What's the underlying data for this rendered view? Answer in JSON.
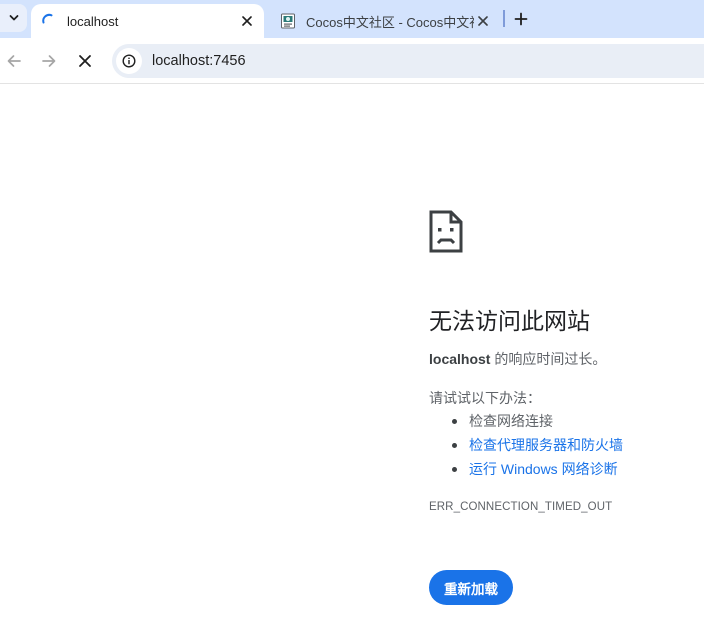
{
  "tabs": [
    {
      "title": "localhost",
      "loading": true
    },
    {
      "title": "Cocos中文社区 - Cocos中文社"
    }
  ],
  "omnibox": {
    "url": "localhost:7456"
  },
  "error_page": {
    "heading": "无法访问此网站",
    "summary_host": "localhost",
    "summary_rest": " 的响应时间过长。",
    "suggestions_heading": "请试试以下办法：",
    "suggestions": [
      {
        "label": "检查网络连接",
        "link": false
      },
      {
        "label": "检查代理服务器和防火墙",
        "link": true
      },
      {
        "label": "运行 Windows 网络诊断",
        "link": true
      }
    ],
    "error_code": "ERR_CONNECTION_TIMED_OUT",
    "reload_label": "重新加载"
  },
  "colors": {
    "tabstrip_bg": "#d3e3fd",
    "accent_blue": "#1a73e8",
    "omnibox_bg": "#e9eef6"
  },
  "icons": {
    "tab_search": "chevron-down-icon",
    "loading": "spinner-icon",
    "close": "close-icon",
    "new_tab": "plus-icon",
    "back": "arrow-left-icon",
    "forward": "arrow-right-icon",
    "stop": "stop-x-icon",
    "site_info": "info-circle-icon",
    "error": "sad-page-icon"
  }
}
